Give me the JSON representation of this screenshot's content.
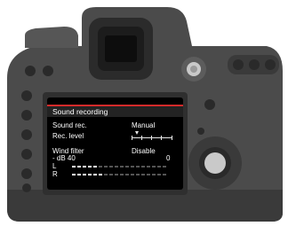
{
  "menu": {
    "title": "Sound recording",
    "sound_rec": {
      "label": "Sound rec.",
      "value": "Manual"
    },
    "rec_level": {
      "label": "Rec. level",
      "level_fraction": 0.1
    },
    "wind_filter": {
      "label": "Wind filter",
      "value": "Disable"
    },
    "meter_scale": {
      "left": "- dB 40",
      "right": "0"
    },
    "meters": [
      {
        "channel": "L",
        "level_fraction": 0.3
      },
      {
        "channel": "R",
        "level_fraction": 0.35
      }
    ]
  },
  "colors": {
    "body": "#4b4b4b",
    "body_dark": "#2f2f2f",
    "header_bar": "#d42a2a",
    "screen_bg": "#000000"
  },
  "icons": [
    "shutter-button-icon",
    "eyepiece-icon",
    "dial-icon",
    "multi-controller-icon"
  ]
}
